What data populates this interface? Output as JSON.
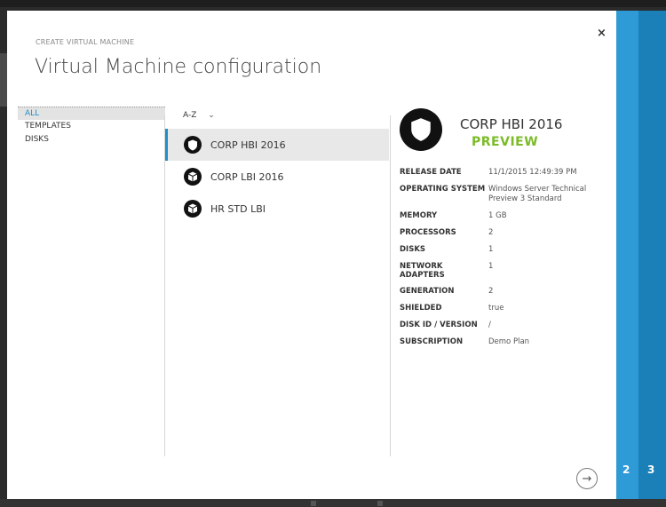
{
  "header": {
    "subtitle": "CREATE VIRTUAL MACHINE",
    "title": "Virtual Machine configuration",
    "close": "×"
  },
  "filters": [
    {
      "label": "ALL",
      "active": true
    },
    {
      "label": "TEMPLATES",
      "active": false
    },
    {
      "label": "DISKS",
      "active": false
    }
  ],
  "sort": {
    "label": "A-Z",
    "chevron": "⌄"
  },
  "vms": [
    {
      "label": "CORP HBI 2016",
      "icon": "shield-icon",
      "selected": true
    },
    {
      "label": "CORP LBI 2016",
      "icon": "cube-icon",
      "selected": false
    },
    {
      "label": "HR STD LBI",
      "icon": "cube-icon",
      "selected": false
    }
  ],
  "detail": {
    "name": "CORP HBI 2016",
    "badge": "PREVIEW",
    "properties": [
      {
        "key": "RELEASE DATE",
        "value": "11/1/2015 12:49:39 PM"
      },
      {
        "key": "OPERATING SYSTEM",
        "value": "Windows Server Technical Preview 3 Standard"
      },
      {
        "key": "MEMORY",
        "value": "1 GB"
      },
      {
        "key": "PROCESSORS",
        "value": "2"
      },
      {
        "key": "DISKS",
        "value": "1"
      },
      {
        "key": "NETWORK ADAPTERS",
        "value": "1"
      },
      {
        "key": "GENERATION",
        "value": "2"
      },
      {
        "key": "SHIELDED",
        "value": "true"
      },
      {
        "key": "DISK ID / VERSION",
        "value": "/"
      },
      {
        "key": "SUBSCRIPTION",
        "value": "Demo Plan"
      }
    ]
  },
  "steps": [
    {
      "label": "2"
    },
    {
      "label": "3"
    }
  ],
  "colors": {
    "accent": "#1f8ec9",
    "preview": "#7cbb28",
    "rail": "#2e9ad6"
  }
}
